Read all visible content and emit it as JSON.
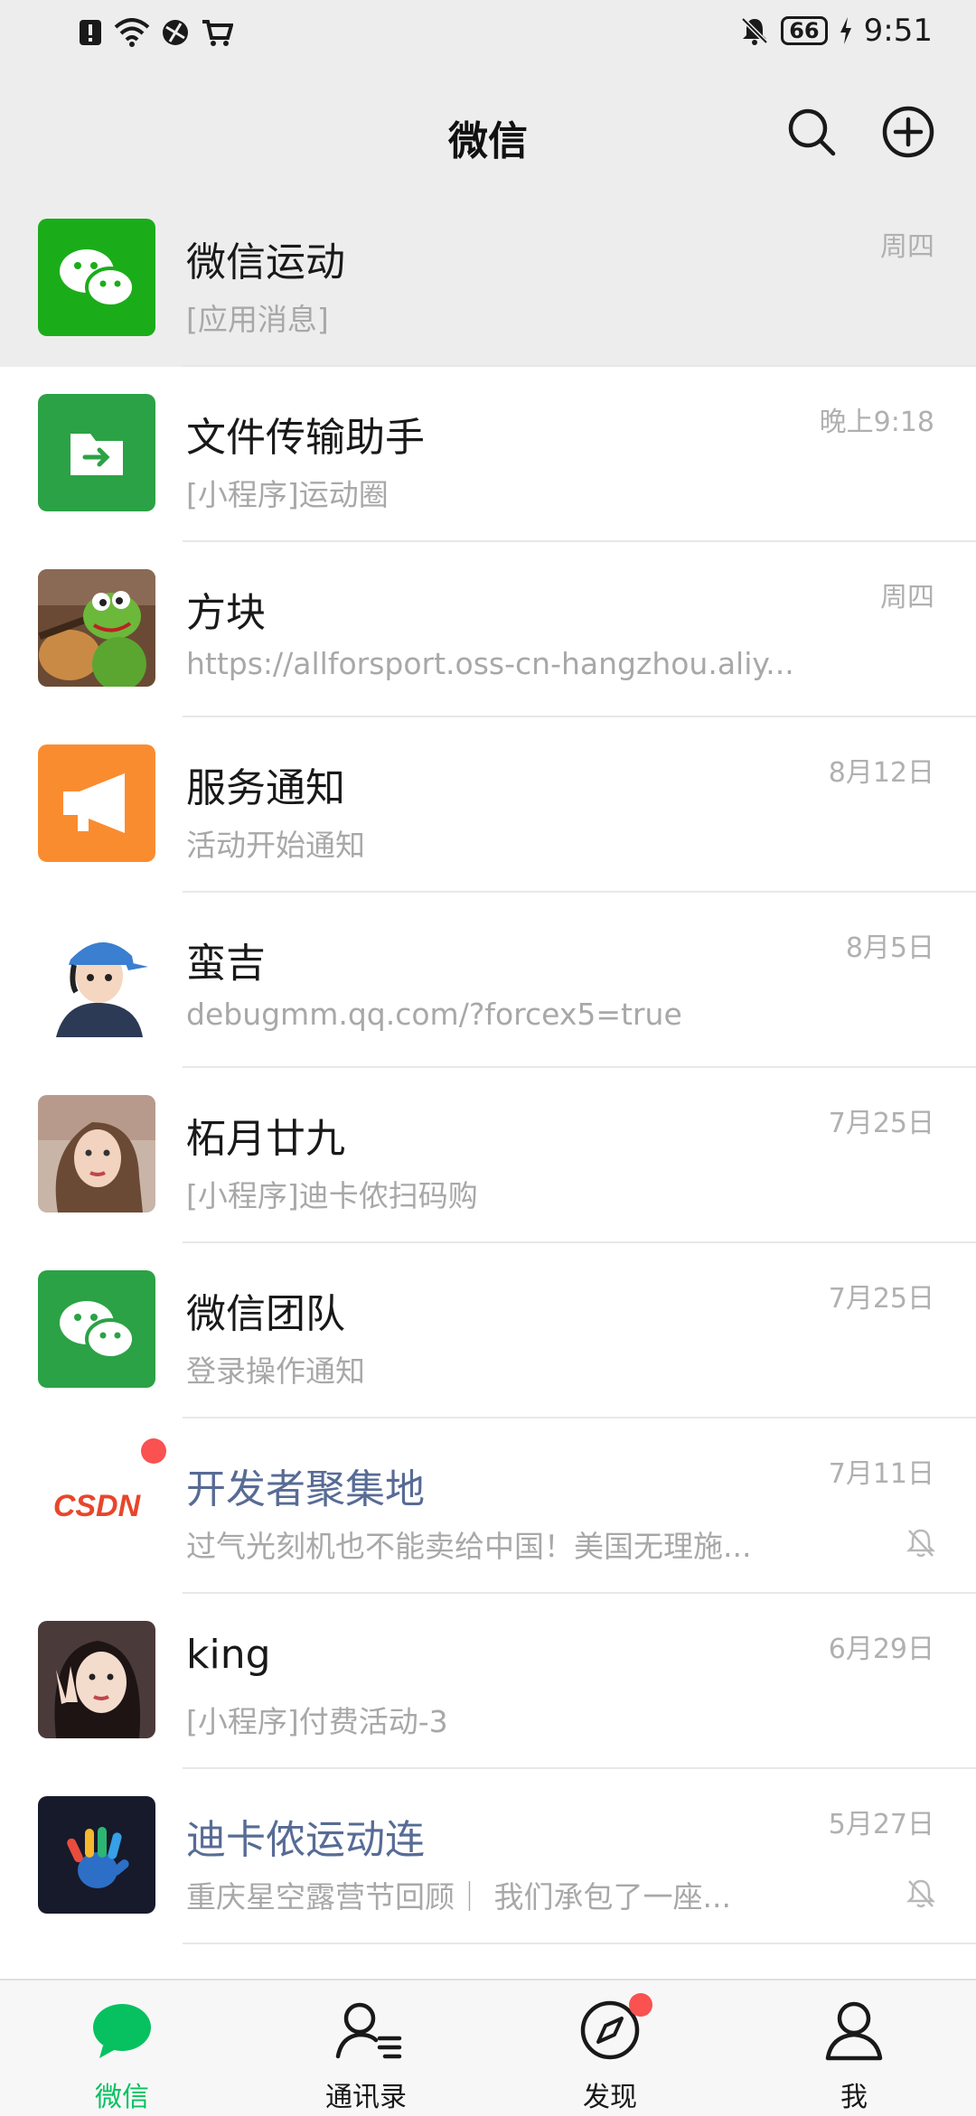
{
  "status_bar": {
    "time": "9:51",
    "battery": "66",
    "icons": [
      "alert-icon",
      "wifi-icon",
      "vpn-globe-icon",
      "cart-icon",
      "mute-bell-icon",
      "charging-icon"
    ]
  },
  "header": {
    "title": "微信",
    "icons": [
      "search-icon",
      "add-circle-icon"
    ]
  },
  "colors": {
    "accent_green": "#07c160",
    "official_blue": "#576b95",
    "unread_red": "#fa5151",
    "background_gray": "#ededed"
  },
  "chats": [
    {
      "name": "微信运动",
      "preview": "[应用消息]",
      "time": "周四",
      "pinned": true,
      "avatar": "wechat-logo"
    },
    {
      "name": "文件传输助手",
      "preview": "[小程序]运动圈",
      "time": "晚上9:18",
      "avatar": "file-transfer"
    },
    {
      "name": "方块",
      "preview": "https://allforsport.oss-cn-hangzhou.aliy...",
      "time": "周四",
      "avatar": "kermit-photo"
    },
    {
      "name": "服务通知",
      "preview": "活动开始通知",
      "time": "8月12日",
      "avatar": "megaphone"
    },
    {
      "name": "蛮吉",
      "preview": "debugmm.qq.com/?forcex5=true",
      "time": "8月5日",
      "avatar": "cartoon-boy"
    },
    {
      "name": "柘月廿九",
      "preview": "[小程序]迪卡侬扫码购",
      "time": "7月25日",
      "avatar": "woman-portrait"
    },
    {
      "name": "微信团队",
      "preview": "登录操作通知",
      "time": "7月25日",
      "avatar": "wechat-logo"
    },
    {
      "name": "开发者聚集地",
      "preview": "过气光刻机也不能卖给中国！美国无理施...",
      "time": "7月11日",
      "official": true,
      "muted": true,
      "unread": true,
      "avatar": "csdn-logo",
      "avatar_text": "CSDN"
    },
    {
      "name": "king",
      "preview": "[小程序]付费活动-3",
      "time": "6月29日",
      "avatar": "girl-selfie"
    },
    {
      "name": "迪卡侬运动连",
      "preview": "重庆星空露营节回顾｜ 我们承包了一座...",
      "time": "5月27日",
      "official": true,
      "muted": true,
      "avatar": "hand-logo"
    }
  ],
  "tabs": [
    {
      "label": "微信",
      "icon": "chat-bubble-icon",
      "active": true
    },
    {
      "label": "通讯录",
      "icon": "contacts-icon"
    },
    {
      "label": "发现",
      "icon": "compass-icon",
      "badge_dot": true
    },
    {
      "label": "我",
      "icon": "profile-icon"
    }
  ]
}
